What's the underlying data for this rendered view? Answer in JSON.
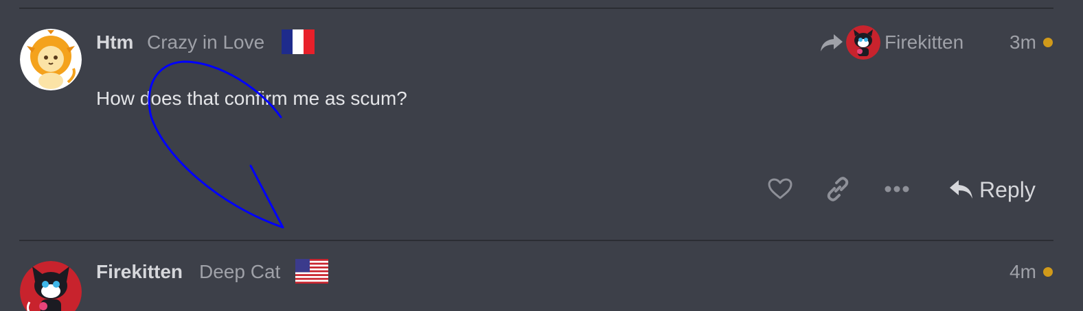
{
  "posts": [
    {
      "username": "Htm",
      "user_title": "Crazy in Love",
      "flag_icon": "france-flag-icon",
      "reply_to": {
        "icon": "share-arrow-icon",
        "username": "Firekitten"
      },
      "time": "3m",
      "body": "How does that confirm me as scum?",
      "actions": {
        "like_icon": "heart-icon",
        "link_icon": "link-icon",
        "more_icon": "ellipsis-icon",
        "reply_label": "Reply"
      }
    },
    {
      "username": "Firekitten",
      "user_title": "Deep Cat",
      "flag_icon": "usa-flag-icon",
      "time": "4m"
    }
  ],
  "colors": {
    "background": "#3d4049",
    "divider": "#2b2d33",
    "unread_dot": "#d19a1a",
    "annotation_stroke": "#0000ff"
  }
}
